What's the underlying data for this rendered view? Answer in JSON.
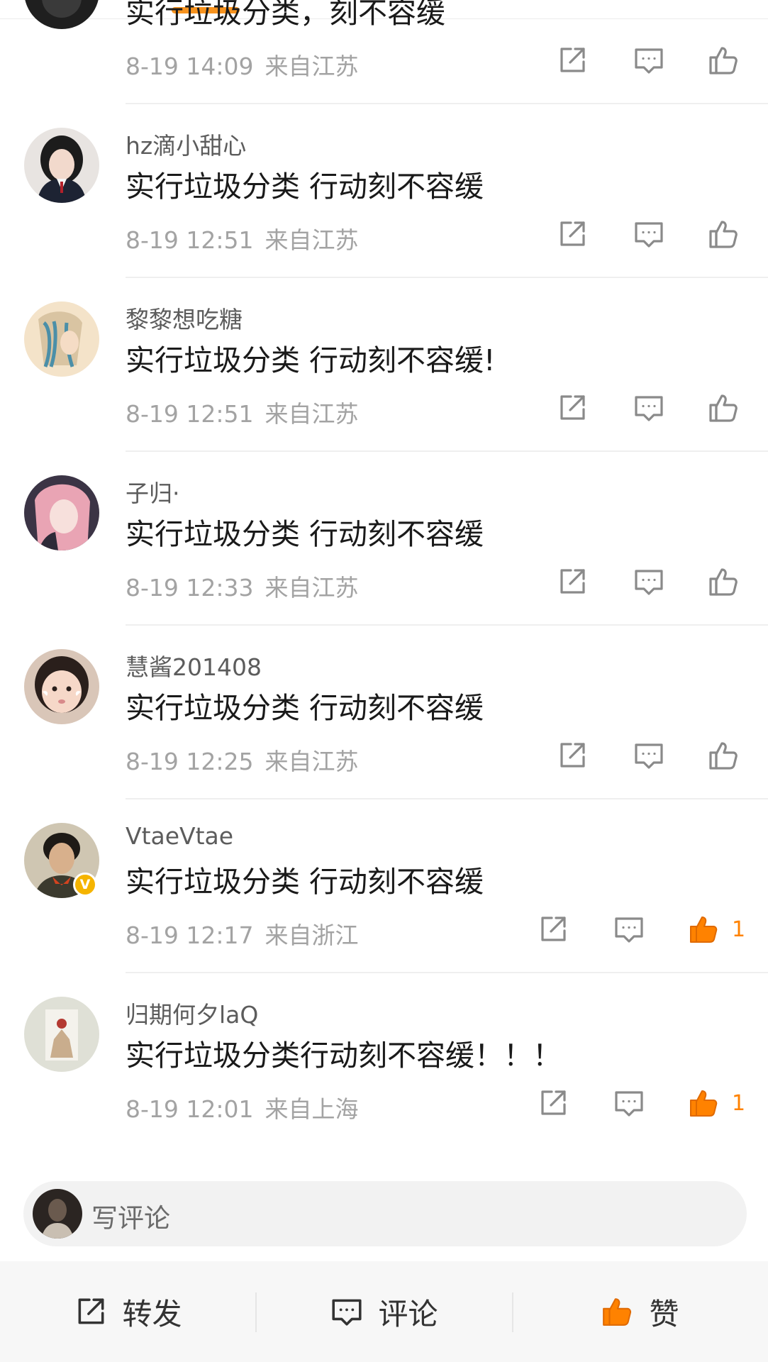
{
  "comments": [
    {
      "username": "",
      "text": "实行垃圾分类，刻不容缓",
      "time": "8-19 14:09",
      "location": "来自江苏",
      "like_count": ""
    },
    {
      "username": "hz滴小甜心",
      "text": "实行垃圾分类 行动刻不容缓",
      "time": "8-19 12:51",
      "location": "来自江苏",
      "like_count": ""
    },
    {
      "username": "黎黎想吃糖",
      "text": "实行垃圾分类 行动刻不容缓!",
      "time": "8-19 12:51",
      "location": "来自江苏",
      "like_count": ""
    },
    {
      "username": "子归·",
      "text": "实行垃圾分类 行动刻不容缓",
      "time": "8-19 12:33",
      "location": "来自江苏",
      "like_count": ""
    },
    {
      "username": "慧酱201408",
      "text": "实行垃圾分类 行动刻不容缓",
      "time": "8-19 12:25",
      "location": "来自江苏",
      "like_count": ""
    },
    {
      "username": "VtaeVtae",
      "text": "实行垃圾分类 行动刻不容缓",
      "time": "8-19 12:17",
      "location": "来自浙江",
      "like_count": "1",
      "verified_badge": "V"
    },
    {
      "username": "归期何夕laQ",
      "text": "实行垃圾分类行动刻不容缓！！！",
      "time": "8-19 12:01",
      "location": "来自上海",
      "like_count": "1"
    }
  ],
  "comment_input": {
    "placeholder": "写评论"
  },
  "bottom_bar": {
    "repost": "转发",
    "comment": "评论",
    "like": "赞"
  },
  "colors": {
    "accent": "#ff8200",
    "indicator": "#f7931e",
    "meta": "#a3a3a3",
    "icon": "#8a8a8a"
  },
  "icons": {
    "repost": "share-icon",
    "comment": "comment-icon",
    "like": "thumbs-up-icon"
  }
}
